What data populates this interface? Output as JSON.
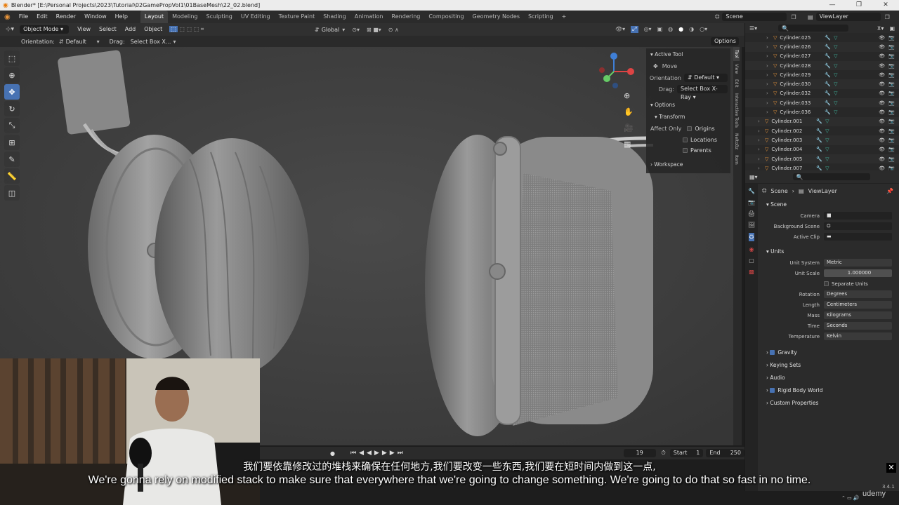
{
  "window": {
    "title": "Blender* [E:\\Personal Projects\\2023\\Tutorial\\02GamePropVol1\\01BaseMesh\\22_02.blend]",
    "controls": [
      "—",
      "❐",
      "✕"
    ]
  },
  "menu": [
    "File",
    "Edit",
    "Render",
    "Window",
    "Help"
  ],
  "workspaces": [
    "Layout",
    "Modeling",
    "Sculpting",
    "UV Editing",
    "Texture Paint",
    "Shading",
    "Animation",
    "Rendering",
    "Compositing",
    "Geometry Nodes",
    "Scripting"
  ],
  "active_workspace": "Layout",
  "scene_name": "Scene",
  "viewlayer_name": "ViewLayer",
  "viewport_header": {
    "mode": "Object Mode",
    "menus": [
      "View",
      "Select",
      "Add",
      "Object"
    ],
    "transform": "Global"
  },
  "tool_settings": {
    "orientation_label": "Orientation:",
    "orientation_value": "Default",
    "drag_label": "Drag:",
    "drag_value": "Select Box X...",
    "options": "Options"
  },
  "npanel": {
    "active_tool": "Active Tool",
    "move": "Move",
    "orientation_label": "Orientation",
    "orientation_value": "Default",
    "drag_label": "Drag:",
    "drag_value": "Select Box X-Ray",
    "options": "Options",
    "transform": "Transform",
    "affect_only": "Affect Only",
    "origins": "Origins",
    "locations": "Locations",
    "parents": "Parents",
    "workspace": "Workspace",
    "tabs": [
      "Tool",
      "View",
      "Edit",
      "Interactive Tools",
      "NeltoBz",
      "Item"
    ]
  },
  "outliner": {
    "rows": [
      "Cylinder.025",
      "Cylinder.026",
      "Cylinder.027",
      "Cylinder.028",
      "Cylinder.029",
      "Cylinder.030",
      "Cylinder.032",
      "Cylinder.033",
      "Cylinder.036",
      "Cylinder.001",
      "Cylinder.002",
      "Cylinder.003",
      "Cylinder.004",
      "Cylinder.005",
      "Cylinder.007"
    ]
  },
  "properties": {
    "breadcrumb_scene": "Scene",
    "breadcrumb_viewlayer": "ViewLayer",
    "scene_section": "Scene",
    "camera_label": "Camera",
    "background_scene_label": "Background Scene",
    "active_clip_label": "Active Clip",
    "units_section": "Units",
    "unit_system_label": "Unit System",
    "unit_system_value": "Metric",
    "unit_scale_label": "Unit Scale",
    "unit_scale_value": "1.000000",
    "separate_units": "Separate Units",
    "rotation_label": "Rotation",
    "rotation_value": "Degrees",
    "length_label": "Length",
    "length_value": "Centimeters",
    "mass_label": "Mass",
    "mass_value": "Kilograms",
    "time_label": "Time",
    "time_value": "Seconds",
    "temperature_label": "Temperature",
    "temperature_value": "Kelvin",
    "gravity": "Gravity",
    "keying_sets": "Keying Sets",
    "audio": "Audio",
    "rigid_body_world": "Rigid Body World",
    "custom_properties": "Custom Properties"
  },
  "timeline": {
    "current_frame": "19",
    "start_label": "Start",
    "start_value": "1",
    "end_label": "End",
    "end_value": "250"
  },
  "version": "3.4.1",
  "watermark": "udemy",
  "subtitles": {
    "chinese": "我们要依靠修改过的堆栈来确保在任何地方,我们要改变一些东西,我们要在短时间内做到这一点,",
    "english": "We're gonna rely on modified stack to make sure that everywhere that we're going to change something. We're going to do that so fast in no time."
  },
  "colors": {
    "accent": "#4772b3",
    "object_icon": "#e8943a",
    "mesh_icon": "#3fb8a0"
  }
}
